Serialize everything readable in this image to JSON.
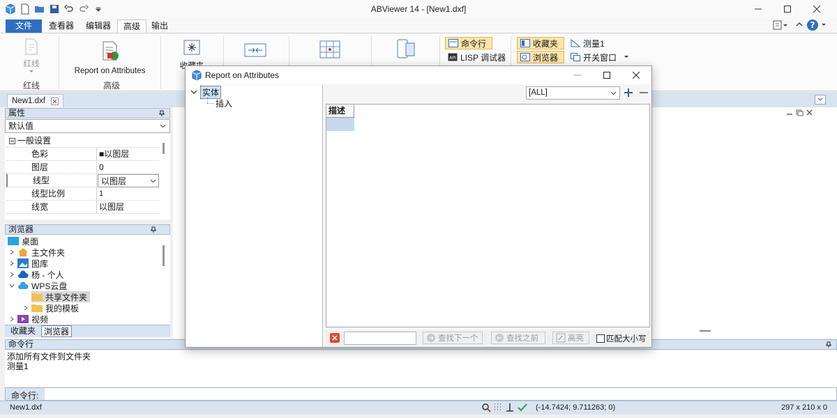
{
  "window": {
    "title": "ABViewer 14 - [New1.dxf]",
    "controls": [
      "minimize",
      "maximize",
      "close"
    ]
  },
  "menu": {
    "file": "文件",
    "tabs": [
      "查看器",
      "编辑器",
      "高级",
      "输出"
    ],
    "active": "高级"
  },
  "ribbon": {
    "redline_label": "红线",
    "redline_group": "红线",
    "report_label": "Report on Attributes",
    "advanced_group": "高级",
    "favorites_label": "收藏夹",
    "cmdline_btn": "命令行",
    "lisp_btn": "LISP 调试器",
    "fav_btn": "收藏夹",
    "browser_btn": "浏览器",
    "measure_btn": "测量1",
    "switch_btn": "开关窗口"
  },
  "doc_tab": "New1.dxf",
  "properties": {
    "header": "属性",
    "selector": "默认值",
    "section": "一般设置",
    "rows": [
      {
        "key": "色彩",
        "value": "■以图层"
      },
      {
        "key": "图层",
        "value": "0"
      },
      {
        "key": "线型",
        "value": "以图层"
      },
      {
        "key": "线型比例",
        "value": "1"
      },
      {
        "key": "线宽",
        "value": "以图层"
      }
    ]
  },
  "browser": {
    "header": "浏览器",
    "items": [
      "桌面",
      "主文件夹",
      "图库",
      "杨 - 个人",
      "WPS云盘",
      "共享文件夹",
      "我的模板",
      "视频"
    ],
    "bottom_tabs": [
      "收藏夹",
      "浏览器"
    ]
  },
  "command": {
    "header": "命令行",
    "log": [
      "添加所有文件到文件夹",
      "测量1"
    ],
    "prompt": "命令行:"
  },
  "status": {
    "file": "New1.dxf",
    "coords": "(-14.7424; 9.711263; 0)",
    "paper": "297 x 210 x 0"
  },
  "dialog": {
    "title": "Report on Attributes",
    "tree_root": "实体",
    "tree_child": "插入",
    "filter_value": "[ALL]",
    "column_header": "描述",
    "find_next": "查找下一个",
    "find_prev": "查找之前",
    "highlight": "高亮",
    "match_case": "匹配大小写"
  }
}
